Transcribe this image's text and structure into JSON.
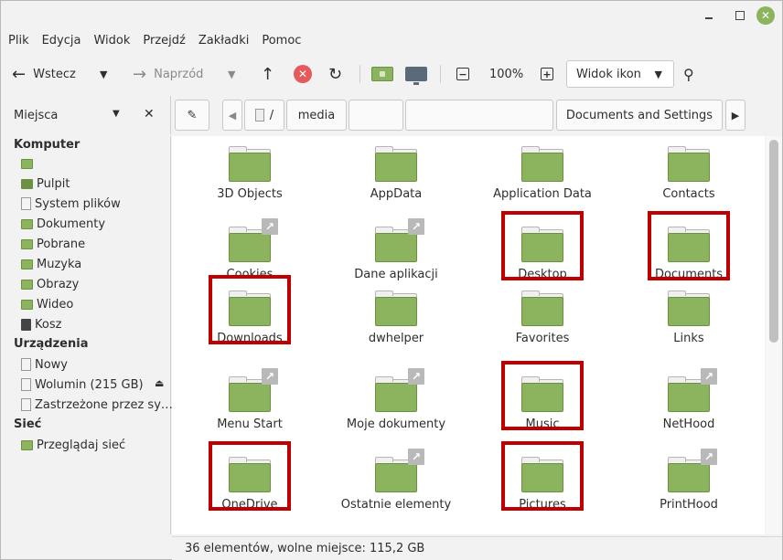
{
  "menu": [
    "Plik",
    "Edycja",
    "Widok",
    "Przejdź",
    "Zakładki",
    "Pomoc"
  ],
  "toolbar": {
    "back_label": "Wstecz",
    "forward_label": "Naprzód",
    "zoom_level": "100%",
    "view_mode": "Widok ikon"
  },
  "places": {
    "header": "Miejsca",
    "sections": {
      "computer": "Komputer",
      "devices": "Urządzenia",
      "network": "Sieć"
    },
    "computer_items": [
      "",
      "Pulpit",
      "System plików",
      "Dokumenty",
      "Pobrane",
      "Muzyka",
      "Obrazy",
      "Wideo",
      "Kosz"
    ],
    "device_items": [
      "Nowy",
      "Wolumin (215 GB)",
      "Zastrzeżone przez sy…"
    ],
    "network_items": [
      "Przeglądaj sieć"
    ]
  },
  "breadcrumb": [
    "/",
    "media",
    "",
    "",
    "Documents and Settings"
  ],
  "files": [
    {
      "name": "3D Objects",
      "link": false,
      "highlighted": false
    },
    {
      "name": "AppData",
      "link": false,
      "highlighted": false
    },
    {
      "name": "Application Data",
      "link": false,
      "highlighted": false
    },
    {
      "name": "Contacts",
      "link": false,
      "highlighted": false
    },
    {
      "name": "Cookies",
      "link": true,
      "highlighted": false
    },
    {
      "name": "Dane aplikacji",
      "link": true,
      "highlighted": false
    },
    {
      "name": "Desktop",
      "link": false,
      "highlighted": true
    },
    {
      "name": "Documents",
      "link": false,
      "highlighted": true
    },
    {
      "name": "Downloads",
      "link": false,
      "highlighted": true
    },
    {
      "name": "dwhelper",
      "link": false,
      "highlighted": false
    },
    {
      "name": "Favorites",
      "link": false,
      "highlighted": false
    },
    {
      "name": "Links",
      "link": false,
      "highlighted": false
    },
    {
      "name": "Menu Start",
      "link": true,
      "highlighted": false
    },
    {
      "name": "Moje dokumenty",
      "link": true,
      "highlighted": false
    },
    {
      "name": "Music",
      "link": false,
      "highlighted": true
    },
    {
      "name": "NetHood",
      "link": true,
      "highlighted": false
    },
    {
      "name": "OneDrive",
      "link": false,
      "highlighted": true
    },
    {
      "name": "Ostatnie elementy",
      "link": true,
      "highlighted": false
    },
    {
      "name": "Pictures",
      "link": false,
      "highlighted": true
    },
    {
      "name": "PrintHood",
      "link": true,
      "highlighted": false
    }
  ],
  "status": "36 elementów, wolne miejsce: 115,2 GB",
  "colors": {
    "folder": "#8cb35e",
    "highlight": "#c00000",
    "accent": "#8cb35e"
  }
}
